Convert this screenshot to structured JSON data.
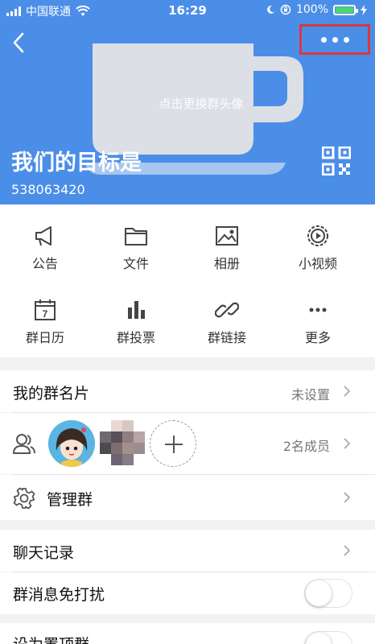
{
  "status_bar": {
    "carrier": "中国联通",
    "time": "16:29",
    "battery": "100%"
  },
  "header": {
    "change_avatar_hint": "点击更换群头像",
    "group_name": "我们的目标是",
    "group_id": "538063420",
    "accent_color": "#4b8ee8",
    "highlight_color": "#d9383f"
  },
  "features": [
    {
      "label": "公告",
      "icon": "megaphone-icon"
    },
    {
      "label": "文件",
      "icon": "folder-icon"
    },
    {
      "label": "相册",
      "icon": "photo-album-icon"
    },
    {
      "label": "小视频",
      "icon": "video-play-icon"
    },
    {
      "label": "群日历",
      "icon": "calendar-icon"
    },
    {
      "label": "群投票",
      "icon": "bar-chart-icon"
    },
    {
      "label": "群链接",
      "icon": "link-icon"
    },
    {
      "label": "更多",
      "icon": "more-dots-icon"
    }
  ],
  "calendar_day": "7",
  "settings": {
    "my_card": {
      "title": "我的群名片",
      "value": "未设置"
    },
    "members": {
      "count": "2名成员"
    },
    "manage": {
      "title": "管理群"
    },
    "chat_history": {
      "title": "聊天记录"
    },
    "do_not_disturb": {
      "title": "群消息免打扰",
      "enabled": false
    },
    "pin_top": {
      "title": "设为置顶群",
      "enabled": false
    }
  }
}
